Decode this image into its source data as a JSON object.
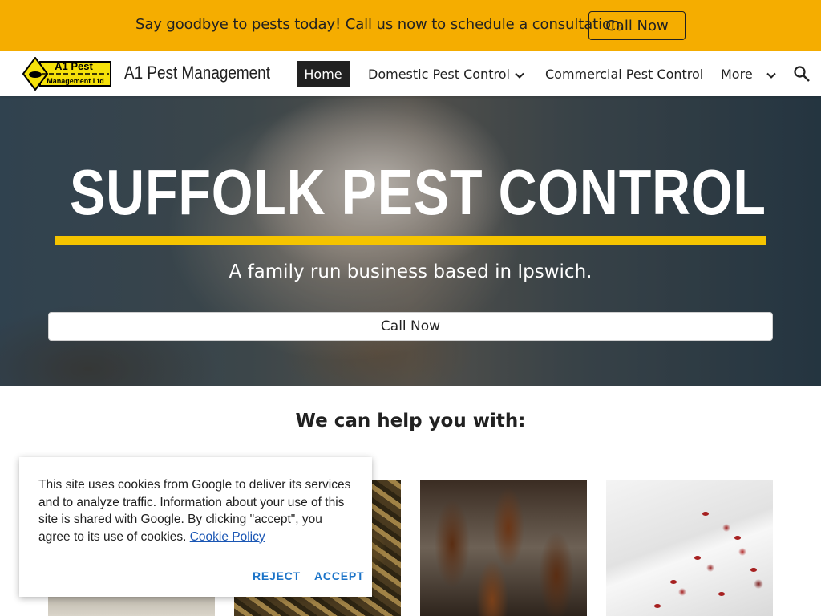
{
  "banner": {
    "text": "Say goodbye to pests today! Call us now to schedule a consultation.",
    "button_label": "Call Now",
    "background_color": "#f5ad00"
  },
  "header": {
    "logo_alt": "A1 Pest Management Ltd",
    "logo_line1": "A1 Pest",
    "logo_line2": "Management Ltd",
    "site_title": "A1 Pest Management",
    "nav": {
      "home": "Home",
      "domestic": "Domestic Pest Control",
      "commercial": "Commercial Pest Control",
      "more": "More"
    },
    "icons": [
      "chevron-down-icon",
      "search-icon"
    ]
  },
  "hero": {
    "title": "SUFFOLK PEST CONTROL",
    "subtitle": "A family run business based in Ipswich.",
    "button_label": "Call Now",
    "accent_color": "#f5c400"
  },
  "help": {
    "heading": "We can help you with:"
  },
  "cookie": {
    "text": "This site uses cookies from Google to deliver its services and to analyze traffic. Information about your use of this site is shared with Google. By clicking \"accept\", you agree to its use of cookies.",
    "link_label": "Cookie Policy",
    "reject_label": "REJECT",
    "accept_label": "ACCEPT",
    "button_color": "#1a73c8"
  }
}
